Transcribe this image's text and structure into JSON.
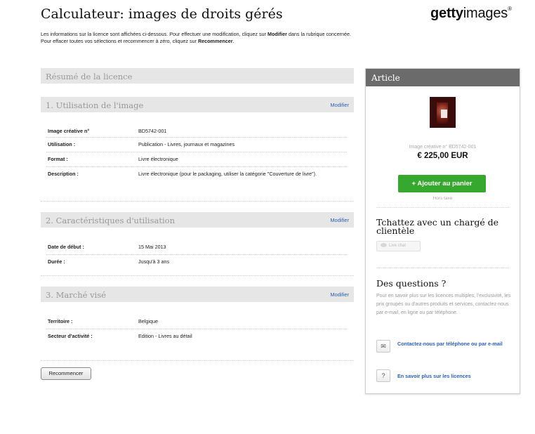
{
  "header": {
    "title": "Calculateur: images de droits gérés",
    "logo_bold": "getty",
    "logo_light": "images",
    "logo_mark": "®"
  },
  "intro": {
    "part1": "Les informations sur la licence sont affichées ci-dessous. Pour effectuer une modification, cliquez sur ",
    "modifier": "Modifier",
    "part2": " dans la rubrique concernée. Pour effacer toutes vos sélections et recommencer à zéro, cliquez sur ",
    "recommencer": "Recommencer",
    "part3": "."
  },
  "summary": {
    "title": "Résumé de la licence"
  },
  "sections": [
    {
      "title": "1. Utilisation de l'image",
      "modify_label": "Modifier",
      "rows": [
        {
          "label": "Image créative n°",
          "value": "BD5742-001"
        },
        {
          "label": "Utilisation :",
          "value": "Publication - Livres, journaux et magazines"
        },
        {
          "label": "Format :",
          "value": "Livre électronique"
        },
        {
          "label": "Description :",
          "value": "Livre électronique (pour le packaging, utiliser la catégorie \"Couverture de livre\")."
        }
      ]
    },
    {
      "title": "2. Caractéristiques d'utilisation",
      "modify_label": "Modifier",
      "rows": [
        {
          "label": "Date de début :",
          "value": "15 Mai 2013"
        },
        {
          "label": "Durée :",
          "value": "Jusqu'à 3 ans"
        }
      ]
    },
    {
      "title": "3. Marché visé",
      "modify_label": "Modifier",
      "rows": [
        {
          "label": "Territoire :",
          "value": "Belgique"
        },
        {
          "label": "Secteur d'activité :",
          "value": "Edition - Livres au détail"
        }
      ]
    }
  ],
  "reset_label": "Recommencer",
  "article": {
    "title": "Article",
    "image_id": "Image créative n° BD5742-001",
    "price": "€ 225,00 EUR",
    "add_to_cart": "+ Ajouter au panier",
    "tax_note": "Hors taxe",
    "chat_title": "Tchattez avec un chargé de clientèle",
    "live_chat": "Live chat",
    "questions_title": "Des questions ?",
    "questions_text": "Pour en savoir plus sur les licences multiples, l'exclusivité, les prix groupés ou d'autres produits et services, contactez-nous par e-mail, en ligne ou par téléphone.",
    "contact_link": "Contactez-nous par téléphone ou par e-mail",
    "learn_link": "En savoir plus sur les licences",
    "learn_icon_glyph": "?",
    "contact_icon": "envelope-icon",
    "learn_icon": "help-icon",
    "chat_icon": "speech-bubble-icon"
  },
  "colors": {
    "accent_green": "#36a82d",
    "link_blue": "#2a61b8",
    "panel_header": "#6b6b6b",
    "section_bar": "#e6e6e6"
  }
}
